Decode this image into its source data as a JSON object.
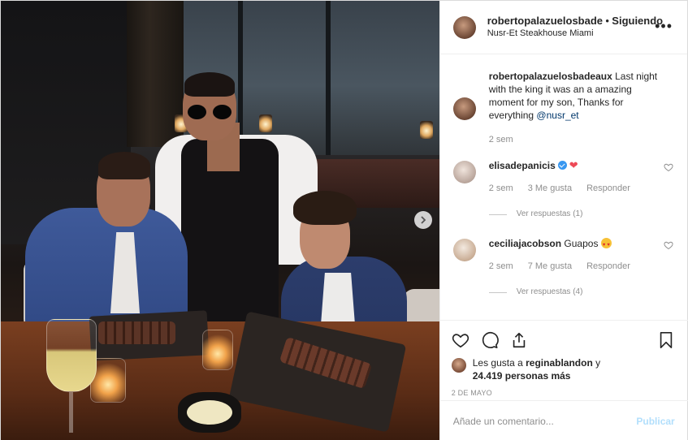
{
  "post": {
    "author": "robertopalazuelosbade",
    "separator": "•",
    "follow_status": "Siguiendo",
    "location": "Nusr-Et Steakhouse Miami",
    "more_icon": "more-horizontal-icon"
  },
  "caption": {
    "user": "robertopalazuelosbadeaux",
    "text": " Last night with the king it was an a amazing moment for my son, Thanks for everything ",
    "mention": "@nusr_et",
    "time": "2 sem"
  },
  "comments": [
    {
      "user": "elisadepanicis",
      "verified": true,
      "emoji": "❤",
      "text": "",
      "time": "2 sem",
      "likes": "3 Me gusta",
      "reply_label": "Responder",
      "view_replies": "Ver respuestas (1)"
    },
    {
      "user": "ceciliajacobson",
      "verified": false,
      "text": " Guapos ",
      "emoji": "heart-eyes",
      "time": "2 sem",
      "likes": "7 Me gusta",
      "reply_label": "Responder",
      "view_replies": "Ver respuestas (4)"
    }
  ],
  "actions": {
    "icons": [
      "heart-icon",
      "comment-icon",
      "share-icon",
      "bookmark-icon"
    ],
    "liked_by_prefix": "Les gusta a ",
    "liked_by_user": "reginablandon",
    "liked_by_suffix": " y",
    "others": "24.419 personas más",
    "date": "2 DE MAYO"
  },
  "add_comment": {
    "placeholder": "Añade un comentario...",
    "publish_label": "Publicar"
  },
  "colors": {
    "link": "#00376b",
    "verified": "#3897f0",
    "heart": "#ed4956",
    "publish_disabled": "#b2dffc"
  }
}
